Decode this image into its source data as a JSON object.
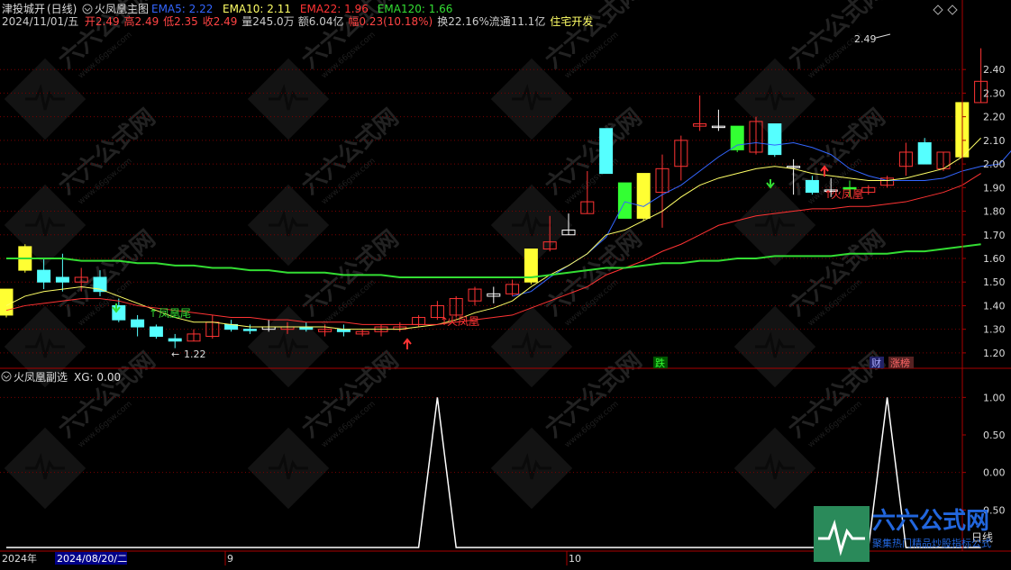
{
  "header": {
    "stock_name": "津投城开",
    "period": "(日线)",
    "indicator_name": "火凤凰主图",
    "ema_items": [
      {
        "label": "EMA5: 2.22",
        "color": "#3366ff"
      },
      {
        "label": "EMA10: 2.11",
        "color": "#ffff66"
      },
      {
        "label": "EMA22: 1.96",
        "color": "#ff3333"
      },
      {
        "label": "EMA120: 1.66",
        "color": "#33dd33"
      }
    ],
    "quote_items": [
      {
        "label": "2024/11/01/五",
        "color": "#cccccc"
      },
      {
        "label": "开2.49",
        "color": "#ff4444"
      },
      {
        "label": "高2.49",
        "color": "#ff4444"
      },
      {
        "label": "低2.35",
        "color": "#ff4444"
      },
      {
        "label": "收2.49",
        "color": "#ff4444"
      },
      {
        "label": "量245.0万",
        "color": "#cccccc"
      },
      {
        "label": "额6.04亿",
        "color": "#cccccc"
      },
      {
        "label": "幅0.23(10.18%)",
        "color": "#ff4444"
      },
      {
        "label": "换22.16%",
        "color": "#cccccc"
      },
      {
        "label": "流通11.1亿",
        "color": "#cccccc"
      },
      {
        "label": "住宅开发",
        "color": "#ffff66"
      }
    ]
  },
  "sub_header": {
    "indicator_name": "火凤凰副选",
    "value_label": "XG: 0.00"
  },
  "annotations": {
    "fenghuang_wei": "凤凰尾",
    "huo_fenghuang_1": "火凤凰",
    "huo_fenghuang_2": "火凤凰",
    "low_label": "1.22",
    "high_label": "2.49",
    "die_badge": "跌",
    "cai_badge": "财",
    "zhangbang_badge": "涨榜"
  },
  "footer": {
    "year": "2024年",
    "date_box": "2024/08/20/二",
    "month_9": "9",
    "month_10": "10",
    "period_btn": "日线"
  },
  "watermark": {
    "brand": "六六公式网",
    "slogan": "聚集热门精品炒股指标公式",
    "url": "www.66gsw.com"
  },
  "colors": {
    "up": "#ff3333",
    "down": "#55ffff",
    "up_yellow": "#ffff33",
    "down_green": "#33ff33",
    "grid": "#7a0000",
    "axis": "#aa0000"
  },
  "chart_data": [
    {
      "type": "candlestick",
      "title": "火凤凰主图",
      "ylim": [
        1.15,
        2.58
      ],
      "y_ticks": [
        1.2,
        1.3,
        1.4,
        1.5,
        1.6,
        1.7,
        1.8,
        1.9,
        2.0,
        2.1,
        2.2,
        2.3,
        2.4
      ],
      "candles": [
        {
          "o": 1.36,
          "h": 1.47,
          "l": 1.35,
          "c": 1.47,
          "style": "yellow"
        },
        {
          "o": 1.55,
          "h": 1.66,
          "l": 1.54,
          "c": 1.65,
          "style": "yellow"
        },
        {
          "o": 1.55,
          "h": 1.6,
          "l": 1.47,
          "c": 1.5,
          "style": "cyan"
        },
        {
          "o": 1.52,
          "h": 1.62,
          "l": 1.46,
          "c": 1.5,
          "style": "cyan"
        },
        {
          "o": 1.5,
          "h": 1.56,
          "l": 1.46,
          "c": 1.52,
          "style": "red"
        },
        {
          "o": 1.52,
          "h": 1.55,
          "l": 1.44,
          "c": 1.46,
          "style": "cyan"
        },
        {
          "o": 1.4,
          "h": 1.43,
          "l": 1.33,
          "c": 1.34,
          "style": "cyan"
        },
        {
          "o": 1.34,
          "h": 1.36,
          "l": 1.27,
          "c": 1.31,
          "style": "cyan"
        },
        {
          "o": 1.31,
          "h": 1.32,
          "l": 1.26,
          "c": 1.27,
          "style": "cyan"
        },
        {
          "o": 1.26,
          "h": 1.28,
          "l": 1.22,
          "c": 1.25,
          "style": "cyan"
        },
        {
          "o": 1.25,
          "h": 1.3,
          "l": 1.25,
          "c": 1.28,
          "style": "red"
        },
        {
          "o": 1.27,
          "h": 1.36,
          "l": 1.26,
          "c": 1.33,
          "style": "red"
        },
        {
          "o": 1.32,
          "h": 1.34,
          "l": 1.29,
          "c": 1.3,
          "style": "cyan"
        },
        {
          "o": 1.3,
          "h": 1.32,
          "l": 1.28,
          "c": 1.3,
          "style": "cyan"
        },
        {
          "o": 1.3,
          "h": 1.34,
          "l": 1.29,
          "c": 1.31,
          "style": "cross"
        },
        {
          "o": 1.3,
          "h": 1.33,
          "l": 1.28,
          "c": 1.31,
          "style": "red"
        },
        {
          "o": 1.31,
          "h": 1.33,
          "l": 1.29,
          "c": 1.3,
          "style": "cyan"
        },
        {
          "o": 1.29,
          "h": 1.32,
          "l": 1.27,
          "c": 1.3,
          "style": "red"
        },
        {
          "o": 1.3,
          "h": 1.32,
          "l": 1.27,
          "c": 1.29,
          "style": "cyan"
        },
        {
          "o": 1.28,
          "h": 1.3,
          "l": 1.27,
          "c": 1.29,
          "style": "red"
        },
        {
          "o": 1.29,
          "h": 1.32,
          "l": 1.27,
          "c": 1.31,
          "style": "red"
        },
        {
          "o": 1.3,
          "h": 1.33,
          "l": 1.29,
          "c": 1.31,
          "style": "red"
        },
        {
          "o": 1.32,
          "h": 1.36,
          "l": 1.31,
          "c": 1.35,
          "style": "red"
        },
        {
          "o": 1.35,
          "h": 1.42,
          "l": 1.34,
          "c": 1.4,
          "style": "red"
        },
        {
          "o": 1.36,
          "h": 1.44,
          "l": 1.35,
          "c": 1.43,
          "style": "red"
        },
        {
          "o": 1.42,
          "h": 1.48,
          "l": 1.4,
          "c": 1.47,
          "style": "red"
        },
        {
          "o": 1.45,
          "h": 1.48,
          "l": 1.41,
          "c": 1.44,
          "style": "cross"
        },
        {
          "o": 1.45,
          "h": 1.51,
          "l": 1.44,
          "c": 1.49,
          "style": "red"
        },
        {
          "o": 1.5,
          "h": 1.63,
          "l": 1.49,
          "c": 1.64,
          "style": "yellow"
        },
        {
          "o": 1.64,
          "h": 1.78,
          "l": 1.63,
          "c": 1.67,
          "style": "red"
        },
        {
          "o": 1.7,
          "h": 1.79,
          "l": 1.7,
          "c": 1.72,
          "style": "cross"
        },
        {
          "o": 1.79,
          "h": 1.97,
          "l": 1.79,
          "c": 1.84,
          "style": "red"
        },
        {
          "o": 1.96,
          "h": 2.14,
          "l": 1.96,
          "c": 2.15,
          "style": "cyan"
        },
        {
          "o": 1.92,
          "h": 1.92,
          "l": 1.77,
          "c": 1.77,
          "style": "green"
        },
        {
          "o": 1.77,
          "h": 1.96,
          "l": 1.76,
          "c": 1.96,
          "style": "yellow"
        },
        {
          "o": 1.88,
          "h": 2.04,
          "l": 1.73,
          "c": 1.98,
          "style": "red"
        },
        {
          "o": 1.99,
          "h": 2.12,
          "l": 1.93,
          "c": 2.1,
          "style": "red"
        },
        {
          "o": 2.16,
          "h": 2.29,
          "l": 2.14,
          "c": 2.17,
          "style": "red"
        },
        {
          "o": 2.16,
          "h": 2.23,
          "l": 2.14,
          "c": 2.16,
          "style": "cross"
        },
        {
          "o": 2.16,
          "h": 2.16,
          "l": 2.05,
          "c": 2.06,
          "style": "green"
        },
        {
          "o": 2.05,
          "h": 2.2,
          "l": 2.04,
          "c": 2.18,
          "style": "red"
        },
        {
          "o": 2.17,
          "h": 2.17,
          "l": 2.03,
          "c": 2.04,
          "style": "cyan"
        },
        {
          "o": 1.99,
          "h": 2.02,
          "l": 1.87,
          "c": 1.99,
          "style": "cross"
        },
        {
          "o": 1.93,
          "h": 1.95,
          "l": 1.87,
          "c": 1.88,
          "style": "cyan"
        },
        {
          "o": 1.89,
          "h": 1.94,
          "l": 1.86,
          "c": 1.89,
          "style": "cross"
        },
        {
          "o": 1.9,
          "h": 1.93,
          "l": 1.86,
          "c": 1.9,
          "style": "green"
        },
        {
          "o": 1.88,
          "h": 1.91,
          "l": 1.87,
          "c": 1.9,
          "style": "red"
        },
        {
          "o": 1.91,
          "h": 1.95,
          "l": 1.9,
          "c": 1.94,
          "style": "red"
        },
        {
          "o": 1.99,
          "h": 2.09,
          "l": 1.95,
          "c": 2.05,
          "style": "red"
        },
        {
          "o": 2.09,
          "h": 2.11,
          "l": 2.0,
          "c": 2.0,
          "style": "cyan"
        },
        {
          "o": 1.98,
          "h": 2.05,
          "l": 1.97,
          "c": 2.05,
          "style": "red"
        },
        {
          "o": 2.03,
          "h": 2.26,
          "l": 2.03,
          "c": 2.26,
          "style": "yellow"
        },
        {
          "o": 2.26,
          "h": 2.49,
          "l": 2.26,
          "c": 2.35,
          "style": "red"
        }
      ],
      "series": [
        {
          "name": "EMA5",
          "color": "#3366ff",
          "start": 27,
          "values": [
            1.44,
            1.46,
            1.52,
            1.57,
            1.62,
            1.69,
            1.84,
            1.82,
            1.87,
            1.91,
            1.97,
            2.03,
            2.08,
            2.09,
            2.08,
            2.09,
            2.07,
            2.04,
            1.98,
            1.95,
            1.93,
            1.93,
            1.93,
            1.94,
            1.97,
            1.99,
            2.0,
            2.09,
            2.22
          ]
        },
        {
          "name": "EMA10",
          "color": "#ffff66",
          "values": [
            1.4,
            1.44,
            1.46,
            1.47,
            1.48,
            1.47,
            1.44,
            1.41,
            1.38,
            1.35,
            1.33,
            1.33,
            1.32,
            1.31,
            1.31,
            1.31,
            1.31,
            1.31,
            1.3,
            1.3,
            1.3,
            1.3,
            1.31,
            1.32,
            1.34,
            1.37,
            1.39,
            1.42,
            1.48,
            1.53,
            1.57,
            1.62,
            1.7,
            1.72,
            1.76,
            1.8,
            1.86,
            1.91,
            1.94,
            1.96,
            1.98,
            1.99,
            1.98,
            1.96,
            1.95,
            1.94,
            1.93,
            1.93,
            1.94,
            1.96,
            1.98,
            2.03,
            2.11
          ]
        },
        {
          "name": "EMA22",
          "color": "#ff3333",
          "values": [
            1.38,
            1.4,
            1.41,
            1.42,
            1.43,
            1.43,
            1.42,
            1.4,
            1.39,
            1.38,
            1.37,
            1.36,
            1.35,
            1.35,
            1.34,
            1.34,
            1.33,
            1.33,
            1.33,
            1.32,
            1.32,
            1.32,
            1.32,
            1.32,
            1.33,
            1.34,
            1.35,
            1.36,
            1.39,
            1.42,
            1.45,
            1.48,
            1.53,
            1.56,
            1.59,
            1.63,
            1.66,
            1.7,
            1.74,
            1.76,
            1.78,
            1.79,
            1.8,
            1.81,
            1.81,
            1.82,
            1.82,
            1.83,
            1.84,
            1.86,
            1.88,
            1.91,
            1.96
          ]
        },
        {
          "name": "EMA120",
          "color": "#33dd33",
          "values": [
            1.6,
            1.6,
            1.6,
            1.6,
            1.59,
            1.59,
            1.59,
            1.58,
            1.58,
            1.57,
            1.57,
            1.56,
            1.56,
            1.55,
            1.55,
            1.54,
            1.54,
            1.54,
            1.53,
            1.53,
            1.53,
            1.52,
            1.52,
            1.52,
            1.52,
            1.52,
            1.52,
            1.52,
            1.52,
            1.53,
            1.54,
            1.55,
            1.56,
            1.56,
            1.57,
            1.58,
            1.58,
            1.59,
            1.59,
            1.6,
            1.6,
            1.61,
            1.61,
            1.61,
            1.61,
            1.62,
            1.62,
            1.62,
            1.63,
            1.63,
            1.64,
            1.65,
            1.66
          ]
        }
      ]
    },
    {
      "type": "line",
      "title": "火凤凰副选",
      "ylim": [
        0,
        1.08
      ],
      "y_ticks": [
        0.0,
        0.5,
        1.0
      ],
      "y_tick_labels": [
        "0.50",
        "0.00",
        "0.50",
        "1.00"
      ],
      "series": [
        {
          "name": "XG",
          "color": "#ffffff",
          "peaks": [
            23,
            47
          ],
          "values_note": "0 except 1 at peaks"
        }
      ]
    }
  ]
}
